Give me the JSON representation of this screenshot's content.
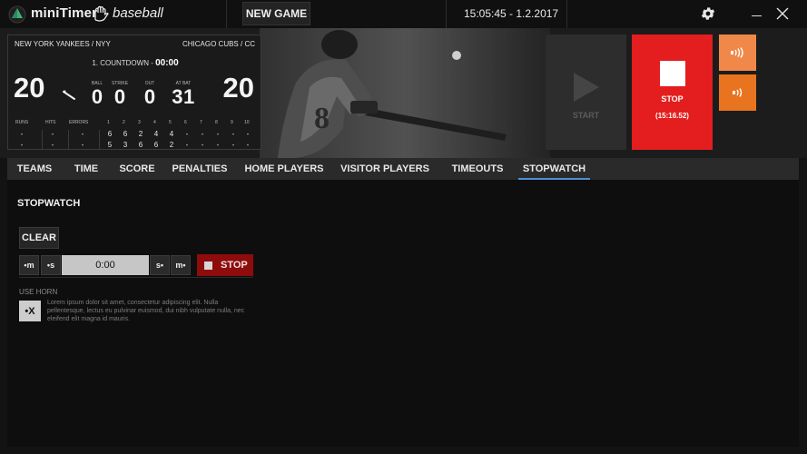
{
  "app": {
    "name": "miniTimer",
    "sport": "baseball",
    "new_game_label": "NEW GAME",
    "clock": "15:05:45 - 1.2.2017"
  },
  "scoreboard": {
    "home_team": "NEW YORK YANKEES / NYY",
    "away_team": "CHICAGO CUBS / CC",
    "period_label": "1. COUNTDOWN - ",
    "period_time": "00:00",
    "home_score": "20",
    "away_score": "20",
    "counts": [
      {
        "label": "BALL",
        "value": "0"
      },
      {
        "label": "STRIKE",
        "value": "0"
      },
      {
        "label": "OUT",
        "value": "0"
      },
      {
        "label": "AT BAT",
        "value": "31"
      }
    ],
    "stat_headers": [
      "RUNS",
      "HITS",
      "ERRORS"
    ],
    "innings": [
      "1",
      "2",
      "3",
      "4",
      "5",
      "6",
      "7",
      "8",
      "9",
      "10"
    ],
    "row_home": {
      "stats": [
        "-",
        "-",
        "-"
      ],
      "innings": [
        "6",
        "6",
        "2",
        "4",
        "4",
        "-",
        "-",
        "-",
        "-",
        "-"
      ]
    },
    "row_away": {
      "stats": [
        "-",
        "-",
        "-"
      ],
      "innings": [
        "5",
        "3",
        "6",
        "6",
        "2",
        "-",
        "-",
        "-",
        "-",
        "-"
      ]
    }
  },
  "controls": {
    "start_label": "START",
    "stop_label": "STOP",
    "stop_time": "(15:16.52)",
    "horn_long_icon": "long-horn-icon",
    "horn_short_icon": "short-horn-icon",
    "colors": {
      "start": "#2d2d2d",
      "stop": "#e41e1e",
      "horn_long": "#f0884a",
      "horn_short": "#e8741f"
    }
  },
  "tabs": [
    {
      "label": "TEAMS"
    },
    {
      "label": "TIME"
    },
    {
      "label": "SCORE"
    },
    {
      "label": "PENALTIES"
    },
    {
      "label": "HOME PLAYERS"
    },
    {
      "label": "VISITOR PLAYERS"
    },
    {
      "label": "TIMEOUTS"
    },
    {
      "label": "STOPWATCH",
      "active": true
    }
  ],
  "stopwatch": {
    "title": "STOPWATCH",
    "clear_label": "CLEAR",
    "minus_minute": "•m",
    "minus_second": "•s",
    "time_value": "0:00",
    "plus_second": "s•",
    "plus_minute": "m•",
    "stop_label": "STOP",
    "horn_label": "USE HORN",
    "horn_description": "Lorem ipsum dolor sit amet, consectetur adipiscing elit. Nulla pellentesque, lectus eu pulvinar euismod, dui nibh vulputate nulla, nec eleifend elit magna id mauris.",
    "horn_toggle_text": "•X"
  }
}
